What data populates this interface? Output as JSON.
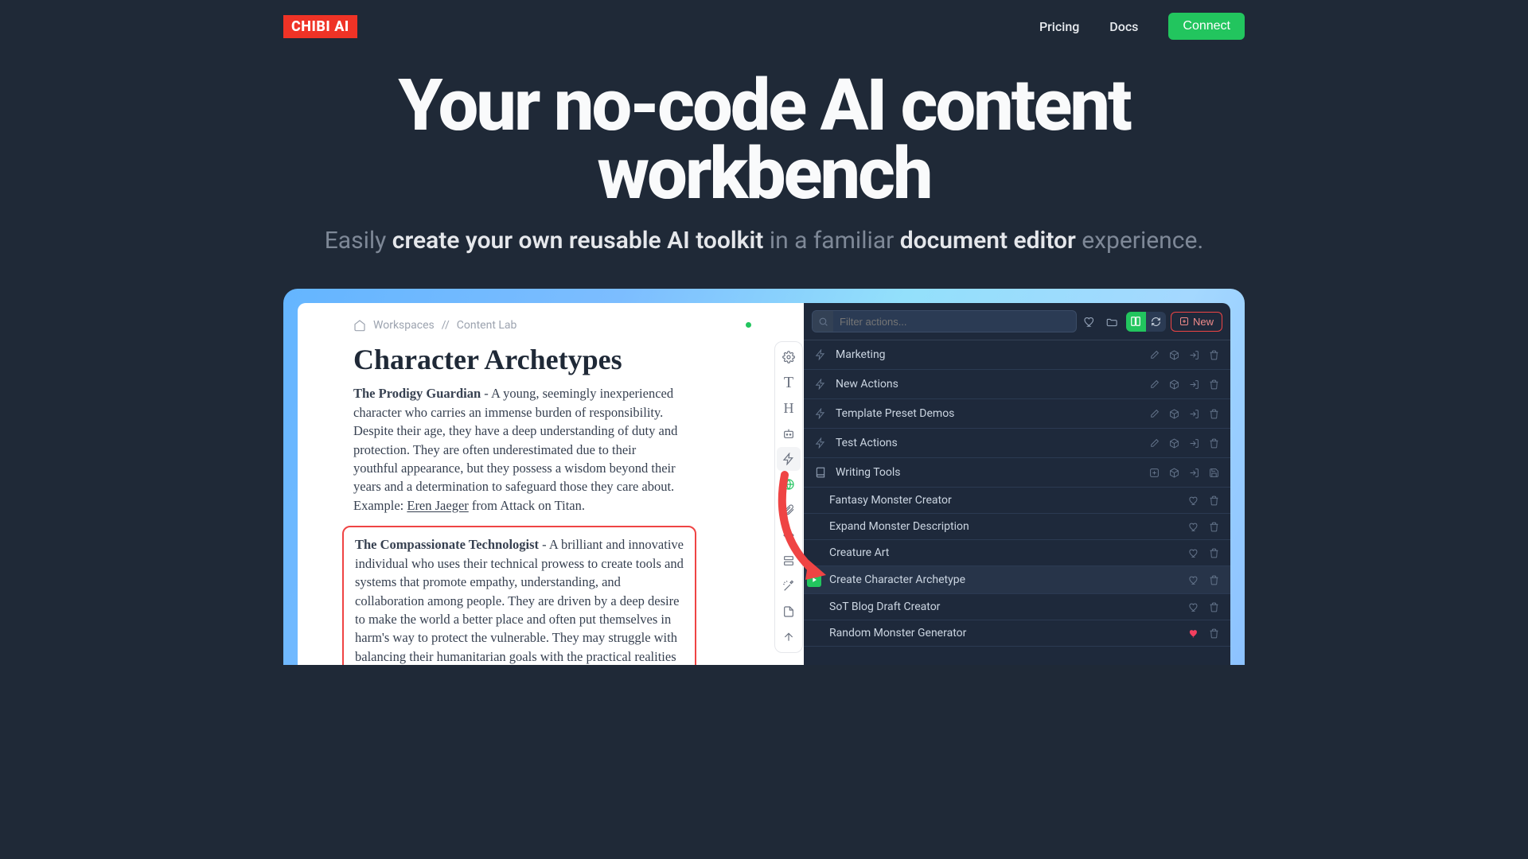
{
  "brand": "CHIBI AI",
  "nav": {
    "pricing": "Pricing",
    "docs": "Docs",
    "connect": "Connect"
  },
  "hero": {
    "title": "Your no-code AI content workbench",
    "sub_plain1": "Easily ",
    "sub_em1": "create your own reusable AI toolkit",
    "sub_plain2": " in a familiar ",
    "sub_em2": "document editor",
    "sub_plain3": " experience."
  },
  "breadcrumb": {
    "workspaces": "Workspaces",
    "sep": "//",
    "lab": "Content Lab"
  },
  "doc": {
    "title": "Character Archetypes",
    "p1_title": "The Prodigy Guardian",
    "p1_body": " - A young, seemingly inexperienced character who carries an immense burden of responsibility. Despite their age, they have a deep understanding of duty and protection. They are often underestimated due to their youthful appearance, but they possess a wisdom beyond their years and a determination to safeguard those they care about. Example: ",
    "p1_example": "Eren Jaeger",
    "p1_tail": " from Attack on Titan.",
    "p2_title": "The Compassionate Technologist",
    "p2_body": " - A brilliant and innovative individual who uses their technical prowess to create tools and systems that promote empathy, understanding, and collaboration among people. They are driven by a deep desire to make the world a better place and often put themselves in harm's way to protect the vulnerable. They may struggle with balancing their humanitarian goals with the practical realities of technology."
  },
  "panel": {
    "search_placeholder": "Filter actions...",
    "new_label": "New",
    "folders": {
      "marketing": "Marketing",
      "new_actions": "New Actions",
      "template_demos": "Template Preset Demos",
      "test_actions": "Test Actions",
      "writing_tools": "Writing Tools"
    },
    "tools": {
      "fantasy": "Fantasy Monster Creator",
      "expand": "Expand Monster Description",
      "creature": "Creature Art",
      "archetype": "Create Character Archetype",
      "sot": "SoT Blog Draft Creator",
      "random": "Random Monster Generator"
    }
  }
}
